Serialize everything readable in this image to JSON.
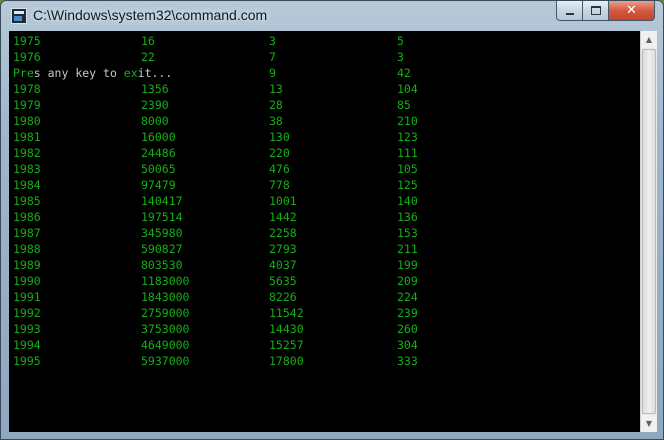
{
  "window": {
    "title": "C:\\Windows\\system32\\command.com",
    "controls": {
      "minimize": "minimize",
      "maximize": "maximize",
      "close": "✕"
    }
  },
  "console": {
    "rows_before": [
      [
        "1975",
        "16",
        "3",
        "5"
      ],
      [
        "1976",
        "22",
        "7",
        "3"
      ]
    ],
    "prompt_row": {
      "text_part1": "Pre",
      "text_part2": "s any key to ",
      "text_part3": "ex",
      "text_part4": "it...",
      "col2": "9",
      "col3": "42"
    },
    "rows_after": [
      [
        "1978",
        "1356",
        "13",
        "104"
      ],
      [
        "1979",
        "2390",
        "28",
        "85"
      ],
      [
        "1980",
        "8000",
        "38",
        "210"
      ],
      [
        "1981",
        "16000",
        "130",
        "123"
      ],
      [
        "1982",
        "24486",
        "220",
        "111"
      ],
      [
        "1983",
        "50065",
        "476",
        "105"
      ],
      [
        "1984",
        "97479",
        "778",
        "125"
      ],
      [
        "1985",
        "140417",
        "1001",
        "140"
      ],
      [
        "1986",
        "197514",
        "1442",
        "136"
      ],
      [
        "1987",
        "345980",
        "2258",
        "153"
      ],
      [
        "1988",
        "590827",
        "2793",
        "211"
      ],
      [
        "1989",
        "803530",
        "4037",
        "199"
      ],
      [
        "1990",
        "1183000",
        "5635",
        "209"
      ],
      [
        "1991",
        "1843000",
        "8226",
        "224"
      ],
      [
        "1992",
        "2759000",
        "11542",
        "239"
      ],
      [
        "1993",
        "3753000",
        "14430",
        "260"
      ],
      [
        "1994",
        "4649000",
        "15257",
        "304"
      ],
      [
        "1995",
        "5937000",
        "17800",
        "333"
      ]
    ]
  },
  "colors": {
    "console_bg": "#000000",
    "text_green": "#12b012",
    "text_gray": "#c8c8c8",
    "close_red": "#c7432a"
  }
}
